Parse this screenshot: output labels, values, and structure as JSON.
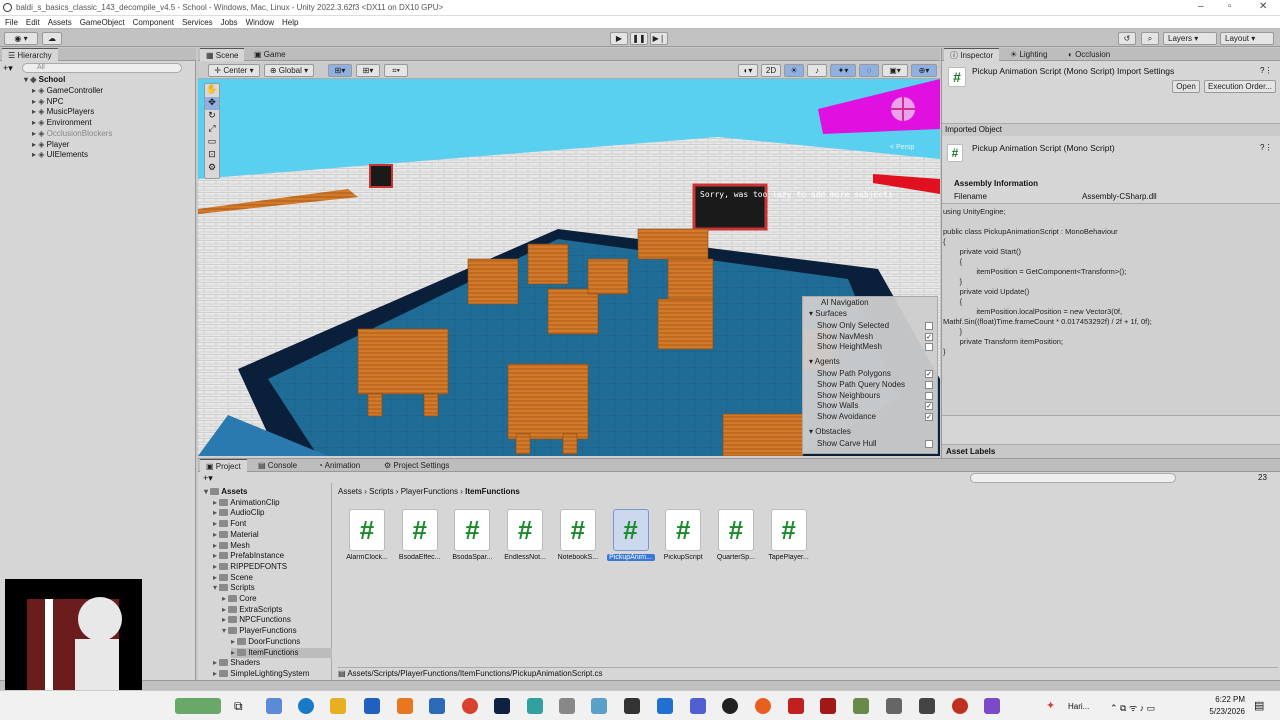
{
  "window": {
    "title": "baldi_s_basics_classic_143_decompile_v4.5 - School - Windows, Mac, Linux - Unity 2022.3.62f3 <DX11 on DX10 GPU>"
  },
  "menu": [
    "File",
    "Edit",
    "Assets",
    "GameObject",
    "Component",
    "Services",
    "Jobs",
    "Window",
    "Help"
  ],
  "toolbar": {
    "layers": "Layers",
    "layout": "Layout"
  },
  "hierarchy": {
    "tab": "Hierarchy",
    "search_placeholder": "All",
    "root": "School",
    "items": [
      "GameController",
      "NPC",
      "MusicPlayers",
      "Environment",
      "OcclusionBlockers",
      "Player",
      "UIElements"
    ]
  },
  "scene": {
    "tabs": [
      "Scene",
      "Game"
    ],
    "pivot": "Center",
    "space": "Global",
    "mode2d": "2D",
    "persp": "< Persp",
    "chalkboard": "Sorry, was too lazy to add more subjects"
  },
  "nav_overlay": {
    "title": "AI Navigation",
    "sections": [
      {
        "name": "Surfaces",
        "items": [
          {
            "label": "Show Only Selected",
            "checked": false
          },
          {
            "label": "Show NavMesh",
            "checked": true
          },
          {
            "label": "Show HeightMesh",
            "checked": false
          }
        ]
      },
      {
        "name": "Agents",
        "items": [
          {
            "label": "Show Path Polygons",
            "checked": true
          },
          {
            "label": "Show Path Query Nodes",
            "checked": false
          },
          {
            "label": "Show Neighbours",
            "checked": false
          },
          {
            "label": "Show Walls",
            "checked": true
          },
          {
            "label": "Show Avoidance",
            "checked": true
          }
        ]
      },
      {
        "name": "Obstacles",
        "items": [
          {
            "label": "Show Carve Hull",
            "checked": false
          }
        ]
      }
    ]
  },
  "inspector": {
    "tabs": [
      "Inspector",
      "Lighting",
      "Occlusion"
    ],
    "header": "Pickup Animation Script (Mono Script) Import Settings",
    "open": "Open",
    "exec": "Execution Order...",
    "imported_object": "Imported Object",
    "object_name": "Pickup Animation Script (Mono Script)",
    "assembly_info": "Assembly Information",
    "filename_label": "Filename",
    "filename_value": "Assembly-CSharp.dll",
    "asset_labels": "Asset Labels",
    "code": [
      "using UnityEngine;",
      "",
      "public class PickupAnimationScript : MonoBehaviour",
      "{",
      "        private void Start()",
      "        {",
      "                itemPosition = GetComponent<Transform>();",
      "        }",
      "        private void Update()",
      "        {",
      "                itemPosition.localPosition = new Vector3(0f,",
      "Mathf.Sin((float)Time.frameCount * 0.017453292f) / 2f + 1f, 0f);",
      "        }",
      "        private Transform itemPosition;",
      "}"
    ]
  },
  "project": {
    "tabs": [
      "Project",
      "Console",
      "Animation",
      "Project Settings"
    ],
    "tree": [
      {
        "label": "Assets",
        "depth": 0
      },
      {
        "label": "AnimationClip",
        "depth": 1
      },
      {
        "label": "AudioClip",
        "depth": 1
      },
      {
        "label": "Font",
        "depth": 1
      },
      {
        "label": "Material",
        "depth": 1
      },
      {
        "label": "Mesh",
        "depth": 1
      },
      {
        "label": "PrefabInstance",
        "depth": 1
      },
      {
        "label": "RIPPEDFONTS",
        "depth": 1
      },
      {
        "label": "Scene",
        "depth": 1
      },
      {
        "label": "Scripts",
        "depth": 1
      },
      {
        "label": "Core",
        "depth": 2
      },
      {
        "label": "ExtraScripts",
        "depth": 2
      },
      {
        "label": "NPCFunctions",
        "depth": 2
      },
      {
        "label": "PlayerFunctions",
        "depth": 2
      },
      {
        "label": "DoorFunctions",
        "depth": 3
      },
      {
        "label": "ItemFunctions",
        "depth": 3
      },
      {
        "label": "Shaders",
        "depth": 1
      },
      {
        "label": "SimpleLightingSystem",
        "depth": 1
      }
    ],
    "breadcrumb": [
      "Assets",
      "Scripts",
      "PlayerFunctions",
      "ItemFunctions"
    ],
    "assets": [
      "AlarmClock...",
      "BsodaEffec...",
      "BsodaSpar...",
      "EndlessNot...",
      "NotebookS...",
      "PickupAnim...",
      "PickupScript",
      "QuarterSp...",
      "TapePlayer..."
    ],
    "selected_index": 5,
    "path": "Assets/Scripts/PlayerFunctions/ItemFunctions/PickupAnimationScript.cs",
    "count": "23"
  },
  "taskbar": {
    "user": "Hari...",
    "time": "6:22 PM",
    "date": "5/23/2026"
  }
}
